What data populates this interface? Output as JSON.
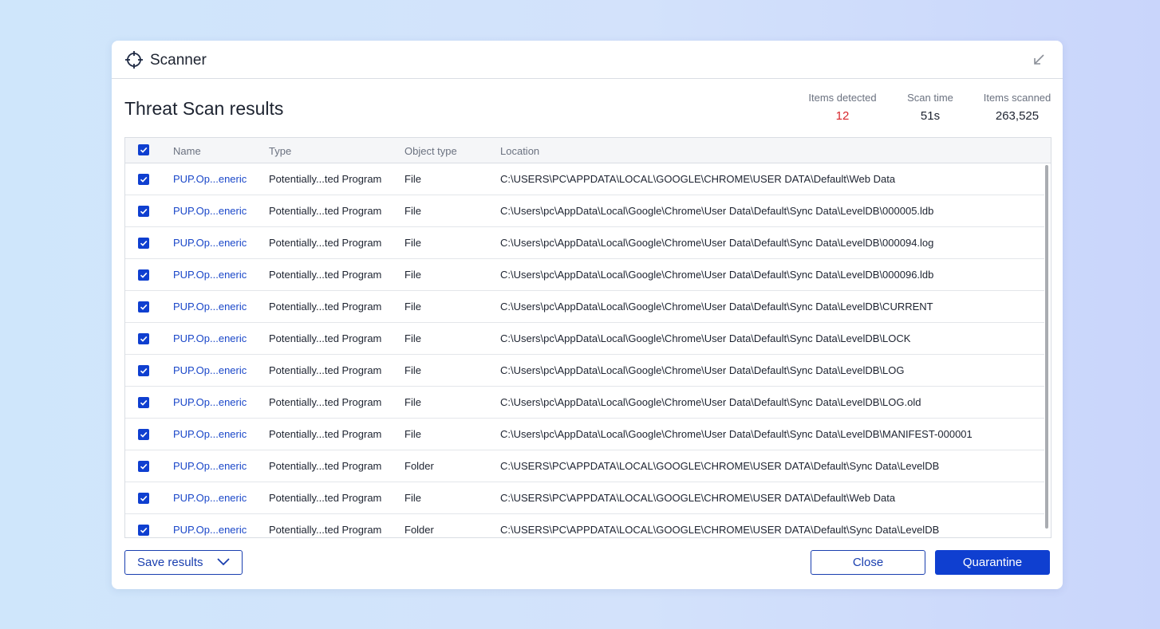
{
  "window": {
    "title": "Scanner",
    "app_icon": "crosshair-icon",
    "minimize_icon": "collapse-arrow-icon"
  },
  "page": {
    "title": "Threat Scan results"
  },
  "stats": {
    "detected": {
      "label": "Items detected",
      "value": "12"
    },
    "time": {
      "label": "Scan time",
      "value": "51s"
    },
    "scanned": {
      "label": "Items scanned",
      "value": "263,525"
    }
  },
  "table": {
    "headers": {
      "name": "Name",
      "type": "Type",
      "object_type": "Object type",
      "location": "Location"
    },
    "rows": [
      {
        "checked": true,
        "name": "PUP.Op...eneric",
        "type": "Potentially...ted Program",
        "object_type": "File",
        "location": "C:\\USERS\\PC\\APPDATA\\LOCAL\\GOOGLE\\CHROME\\USER DATA\\Default\\Web Data"
      },
      {
        "checked": true,
        "name": "PUP.Op...eneric",
        "type": "Potentially...ted Program",
        "object_type": "File",
        "location": "C:\\Users\\pc\\AppData\\Local\\Google\\Chrome\\User Data\\Default\\Sync Data\\LevelDB\\000005.ldb"
      },
      {
        "checked": true,
        "name": "PUP.Op...eneric",
        "type": "Potentially...ted Program",
        "object_type": "File",
        "location": "C:\\Users\\pc\\AppData\\Local\\Google\\Chrome\\User Data\\Default\\Sync Data\\LevelDB\\000094.log"
      },
      {
        "checked": true,
        "name": "PUP.Op...eneric",
        "type": "Potentially...ted Program",
        "object_type": "File",
        "location": "C:\\Users\\pc\\AppData\\Local\\Google\\Chrome\\User Data\\Default\\Sync Data\\LevelDB\\000096.ldb"
      },
      {
        "checked": true,
        "name": "PUP.Op...eneric",
        "type": "Potentially...ted Program",
        "object_type": "File",
        "location": "C:\\Users\\pc\\AppData\\Local\\Google\\Chrome\\User Data\\Default\\Sync Data\\LevelDB\\CURRENT"
      },
      {
        "checked": true,
        "name": "PUP.Op...eneric",
        "type": "Potentially...ted Program",
        "object_type": "File",
        "location": "C:\\Users\\pc\\AppData\\Local\\Google\\Chrome\\User Data\\Default\\Sync Data\\LevelDB\\LOCK"
      },
      {
        "checked": true,
        "name": "PUP.Op...eneric",
        "type": "Potentially...ted Program",
        "object_type": "File",
        "location": "C:\\Users\\pc\\AppData\\Local\\Google\\Chrome\\User Data\\Default\\Sync Data\\LevelDB\\LOG"
      },
      {
        "checked": true,
        "name": "PUP.Op...eneric",
        "type": "Potentially...ted Program",
        "object_type": "File",
        "location": "C:\\Users\\pc\\AppData\\Local\\Google\\Chrome\\User Data\\Default\\Sync Data\\LevelDB\\LOG.old"
      },
      {
        "checked": true,
        "name": "PUP.Op...eneric",
        "type": "Potentially...ted Program",
        "object_type": "File",
        "location": "C:\\Users\\pc\\AppData\\Local\\Google\\Chrome\\User Data\\Default\\Sync Data\\LevelDB\\MANIFEST-000001"
      },
      {
        "checked": true,
        "name": "PUP.Op...eneric",
        "type": "Potentially...ted Program",
        "object_type": "Folder",
        "location": "C:\\USERS\\PC\\APPDATA\\LOCAL\\GOOGLE\\CHROME\\USER DATA\\Default\\Sync Data\\LevelDB"
      },
      {
        "checked": true,
        "name": "PUP.Op...eneric",
        "type": "Potentially...ted Program",
        "object_type": "File",
        "location": "C:\\USERS\\PC\\APPDATA\\LOCAL\\GOOGLE\\CHROME\\USER DATA\\Default\\Web Data"
      },
      {
        "checked": true,
        "name": "PUP.Op...eneric",
        "type": "Potentially...ted Program",
        "object_type": "Folder",
        "location": "C:\\USERS\\PC\\APPDATA\\LOCAL\\GOOGLE\\CHROME\\USER DATA\\Default\\Sync Data\\LevelDB"
      }
    ]
  },
  "footer": {
    "save_label": "Save results",
    "save_icon": "chevron-down-icon",
    "close_label": "Close",
    "quarantine_label": "Quarantine"
  },
  "colors": {
    "accent": "#0f3fd0",
    "link": "#1a47c9",
    "danger": "#d7262c"
  }
}
